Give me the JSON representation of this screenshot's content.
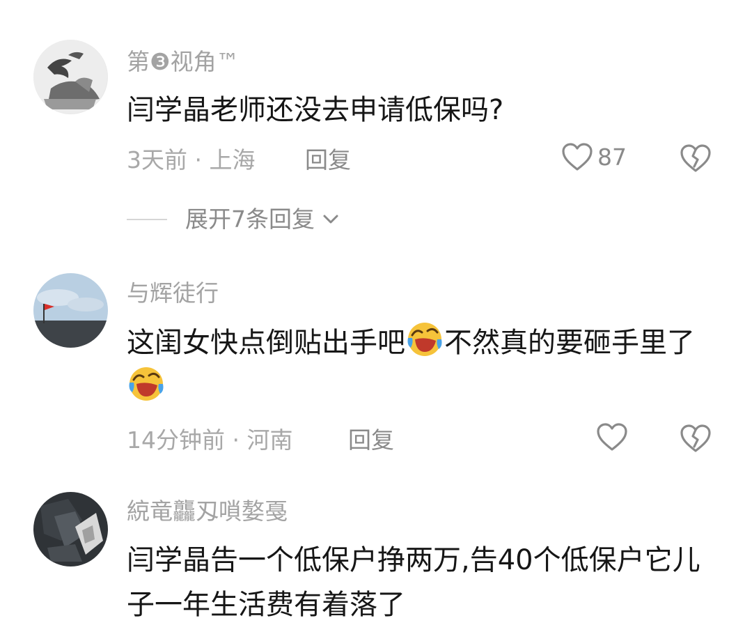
{
  "comments": [
    {
      "username": "第❸视角™",
      "text": "闫学晶老师还没去申请低保吗?",
      "time_location": "3天前 · 上海",
      "reply_label": "回复",
      "like_count": "87",
      "expand_label": "展开7条回复"
    },
    {
      "username": "与辉徒行",
      "text_part1": "这闺女快点倒贴出手吧",
      "text_part2": "不然真的要砸手里了",
      "emoji_icon": "laughing-crying-emoji",
      "time_location": "14分钟前 · 河南",
      "reply_label": "回复",
      "like_count": ""
    },
    {
      "username": "綂竜龘刄嗩嫯戞",
      "text": "闫学晶告一个低保户挣两万,告40个低保户它儿子一年生活费有着落了"
    }
  ],
  "icons": {
    "like": "heart-outline-icon",
    "dislike": "broken-heart-icon",
    "expand": "chevron-down-icon"
  },
  "colors": {
    "text": "#161616",
    "muted": "#a8a8a8",
    "icon": "#8a8a8a"
  }
}
